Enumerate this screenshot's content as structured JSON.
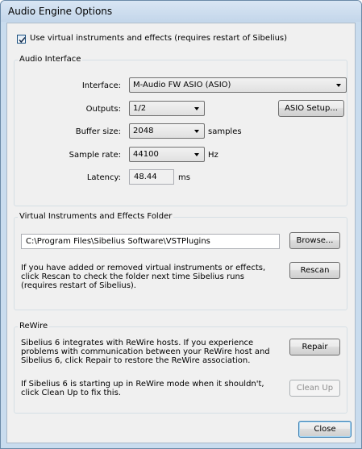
{
  "window": {
    "title": "Audio Engine Options"
  },
  "use_virtual": {
    "checked": true,
    "label": "Use virtual instruments and effects (requires restart of Sibelius)"
  },
  "audio_interface": {
    "legend": "Audio Interface",
    "interface_label": "Interface:",
    "interface_value": "M-Audio FW ASIO (ASIO)",
    "outputs_label": "Outputs:",
    "outputs_value": "1/2",
    "asio_setup_button": "ASIO Setup...",
    "buffer_label": "Buffer size:",
    "buffer_value": "2048",
    "buffer_unit": "samples",
    "sample_rate_label": "Sample rate:",
    "sample_rate_value": "44100",
    "sample_rate_unit": "Hz",
    "latency_label": "Latency:",
    "latency_value": "48.44",
    "latency_unit": "ms"
  },
  "vst_folder": {
    "legend": "Virtual Instruments and Effects Folder",
    "path": "C:\\Program Files\\Sibelius Software\\VSTPlugins",
    "browse_button": "Browse...",
    "info_text": "If you have added or removed virtual instruments or effects, click Rescan to check the folder next time Sibelius runs (requires restart of Sibelius).",
    "rescan_button": "Rescan"
  },
  "rewire": {
    "legend": "ReWire",
    "info_text": "Sibelius 6 integrates with ReWire hosts. If you experience problems with communication between your ReWire host and Sibelius 6, click Repair to restore the ReWire association.",
    "repair_button": "Repair",
    "cleanup_text": "If Sibelius 6 is starting up in ReWire mode when it shouldn't, click Clean Up to fix this.",
    "cleanup_button": "Clean Up"
  },
  "close_button": "Close"
}
